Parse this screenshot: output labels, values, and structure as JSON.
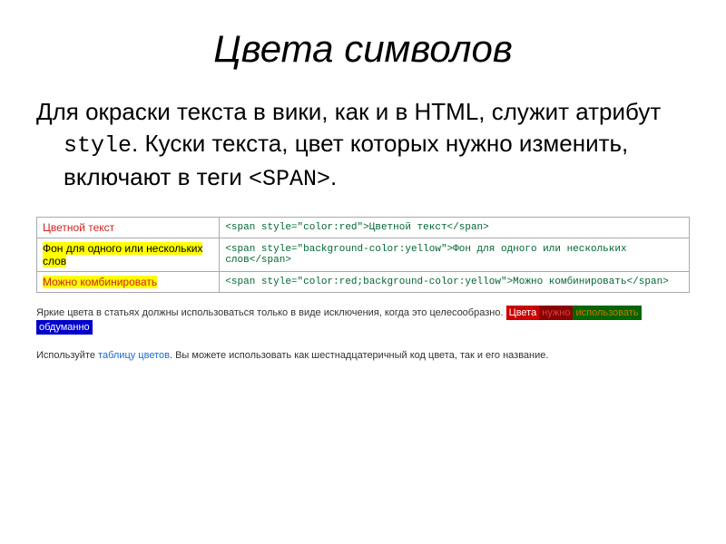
{
  "title": "Цвета символов",
  "paragraph": {
    "p1": "Для окраски текста в вики, как и в HTML, служит атрибут ",
    "attr": "style",
    "p2": ". Куски текста, цвет которых нужно изменить, включают в теги ",
    "tag": "<SPAN>",
    "p3": "."
  },
  "rows": [
    {
      "display": "Цветной текст",
      "code": "<span style=\"color:red\">Цветной текст</span>"
    },
    {
      "display": "Фон для одного или нескольких слов",
      "code": "<span style=\"background-color:yellow\">Фон для одного или нескольких слов</span>"
    },
    {
      "display": "Можно комбинировать",
      "code": "<span style=\"color:red;background-color:yellow\">Можно комбинировать</span>"
    }
  ],
  "note1": {
    "text": "Яркие цвета в статьях должны использоваться только в виде исключения, когда это целесообразно. ",
    "b1": "Цвета",
    "b2": "нужно",
    "b3": "использовать",
    "b4": "обдуманно"
  },
  "note2": {
    "p1": "Используйте ",
    "link": "таблицу цветов",
    "p2": ". Вы можете использовать как шестнадцатеричный код цвета, так и его название."
  }
}
